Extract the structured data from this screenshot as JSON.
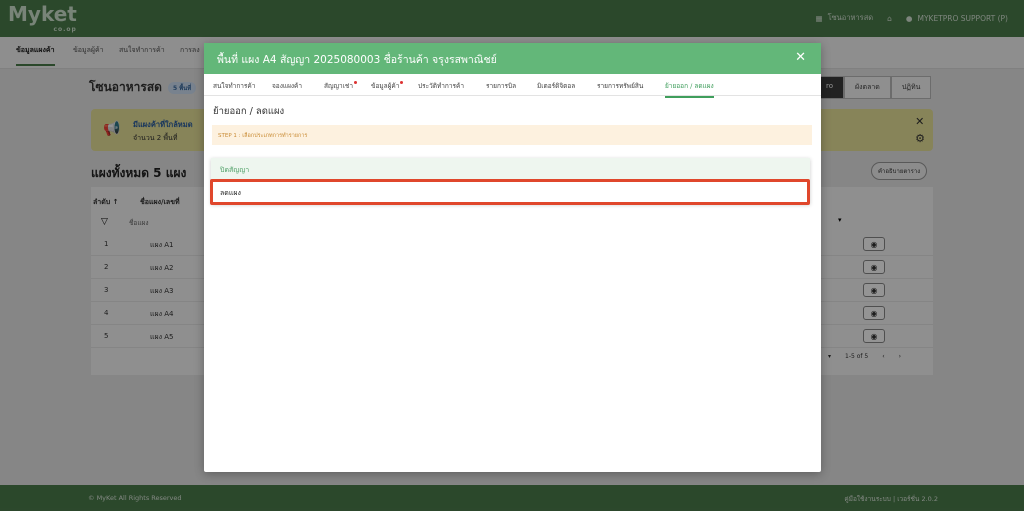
{
  "topbar": {
    "logo": "Myket",
    "logo_sub": "co.op",
    "store_label": "โซนอาหารสด",
    "user_label": "MYKETPRO SUPPORT (P)"
  },
  "subnav": {
    "tabs": [
      "ข้อมูลแผงค้า",
      "ข้อมูลผู้ค้า",
      "สนใจทำการค้า",
      "การลง"
    ]
  },
  "page": {
    "title": "โซนอาหารสด",
    "badge": "5 พื้นที่",
    "buttons": [
      "ro",
      "ผังตลาด",
      "ปฏิทิน"
    ],
    "notice_title": "มีแผงค้าที่ใกล้หมด",
    "notice_count": "จำนวน 2 พื้นที่",
    "section_title": "แผงทั้งหมด 5 แผง",
    "download_btn": "คำอธิบายตาราง",
    "table": {
      "headers": [
        "ลำดับ ↑",
        "ชื่อแผง/เลขที่"
      ],
      "filter_placeholder": "ชื่อแผง",
      "rows": [
        {
          "no": "1",
          "name": "แผง A1"
        },
        {
          "no": "2",
          "name": "แผง A2"
        },
        {
          "no": "3",
          "name": "แผง A3"
        },
        {
          "no": "4",
          "name": "แผง A4"
        },
        {
          "no": "5",
          "name": "แผง A5"
        }
      ],
      "pager_text": "1-5 of 5"
    }
  },
  "footer": {
    "left": "© MyKet All Rights Reserved",
    "right": "คู่มือใช้งานระบบ | เวอร์ชั่น 2.0.2"
  },
  "modal": {
    "title": "พื้นที่ แผง A4 สัญญา 2025080003 ชื่อร้านค้า จรุงรสพาณิชย์",
    "tabs": [
      {
        "label": "สนใจทำการค้า",
        "dot": false
      },
      {
        "label": "จองแผงค้า",
        "dot": false
      },
      {
        "label": "สัญญาเช่า",
        "dot": true
      },
      {
        "label": "ข้อมูลผู้ค้า",
        "dot": true
      },
      {
        "label": "ประวัติทำการค้า",
        "dot": false
      },
      {
        "label": "รายการบิล",
        "dot": false
      },
      {
        "label": "มิเตอร์ดิจิตอล",
        "dot": false
      },
      {
        "label": "รายการทรัพย์สิน",
        "dot": false
      },
      {
        "label": "ย้ายออก / ลดแผง",
        "dot": false,
        "active": true
      }
    ],
    "heading": "ย้ายออก / ลดแผง",
    "step_text": "STEP 1 : เลือกประเภทการทำรายการ",
    "options": [
      "ปิดสัญญา",
      "ลดแผง"
    ]
  }
}
